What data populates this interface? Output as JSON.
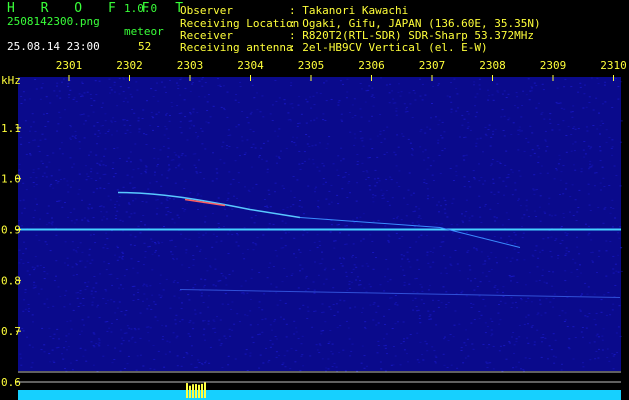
{
  "app": {
    "name": "H R O F F T",
    "version": "1.0.0"
  },
  "file": {
    "name": "2508142300.png",
    "datetime": "25.08.14 23:00"
  },
  "meteor": {
    "label": "meteor",
    "count": "52"
  },
  "info": {
    "observer_label": "Observer",
    "observer_value": ": Takanori Kawachi",
    "location_label": "Receiving Location",
    "location_value": ": Ogaki, Gifu, JAPAN (136.60E, 35.35N)",
    "receiver_label": "Receiver",
    "receiver_value": ": R820T2(RTL-SDR) SDR-Sharp 53.372MHz",
    "antenna_label": "Receiving antenna",
    "antenna_value": ": 2el-HB9CV Vertical (el. E-W)"
  },
  "chart_data": {
    "type": "heatmap",
    "ylabel": "kHz",
    "x_ticks": [
      "2301",
      "2302",
      "2303",
      "2304",
      "2305",
      "2306",
      "2307",
      "2308",
      "2309",
      "2310"
    ],
    "y_ticks": [
      "1.1",
      "1.0",
      "0.9",
      "0.8",
      "0.7",
      "0.6"
    ],
    "ylim": [
      0.6,
      1.2
    ],
    "carrier_khz": 0.9,
    "colors": {
      "background": "#0a0a8c",
      "noise": "#1b1bd0",
      "carrier": "#46d2ff",
      "tick": "#ffff3a",
      "bar": "#16d0ff",
      "bar_peak": "#ffff40"
    }
  }
}
